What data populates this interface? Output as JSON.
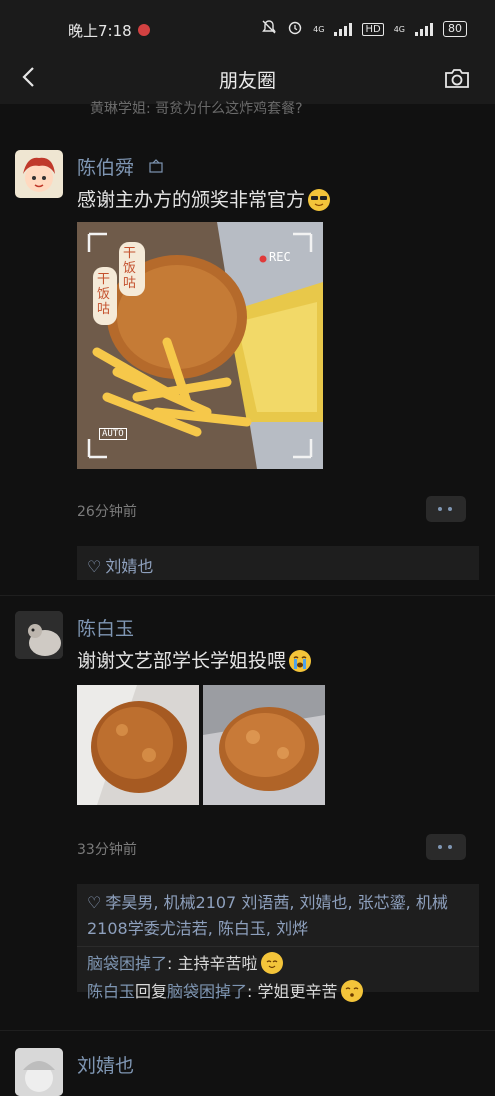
{
  "status": {
    "time": "晚上7:18",
    "network1": "4G",
    "network2": "4G",
    "battery": "80"
  },
  "topbar": {
    "title": "朋友圈"
  },
  "cut_comment": "黄琳学姐: 哥贫为什么这炸鸡套餐?",
  "posts": [
    {
      "author": "陈伯舜",
      "content": "感谢主办方的颁奖非常官方",
      "time": "26分钟前",
      "likes": "刘婧也",
      "photo": {
        "sticker1": "干饭咕",
        "sticker2": "干饭咕",
        "rec_label": "REC",
        "auto_label": "AUTO"
      }
    },
    {
      "author": "陈白玉",
      "content": "谢谢文艺部学长学姐投喂",
      "time": "33分钟前",
      "likes": "李昊男, 机械2107 刘语茜, 刘婧也, 张芯鎏, 机械2108学委尤洁若, 陈白玉, 刘烨",
      "comments": [
        {
          "name": "脑袋困掉了",
          "text": ": 主持辛苦啦"
        },
        {
          "name": "陈白玉",
          "reply": "回复",
          "to": "脑袋困掉了",
          "text": ": 学姐更辛苦"
        }
      ]
    },
    {
      "author": "刘婧也"
    }
  ],
  "colors": {
    "background": "#111111",
    "name_link": "#7f96b3",
    "text": "#e3e3e3",
    "muted": "#7b7b7b"
  }
}
